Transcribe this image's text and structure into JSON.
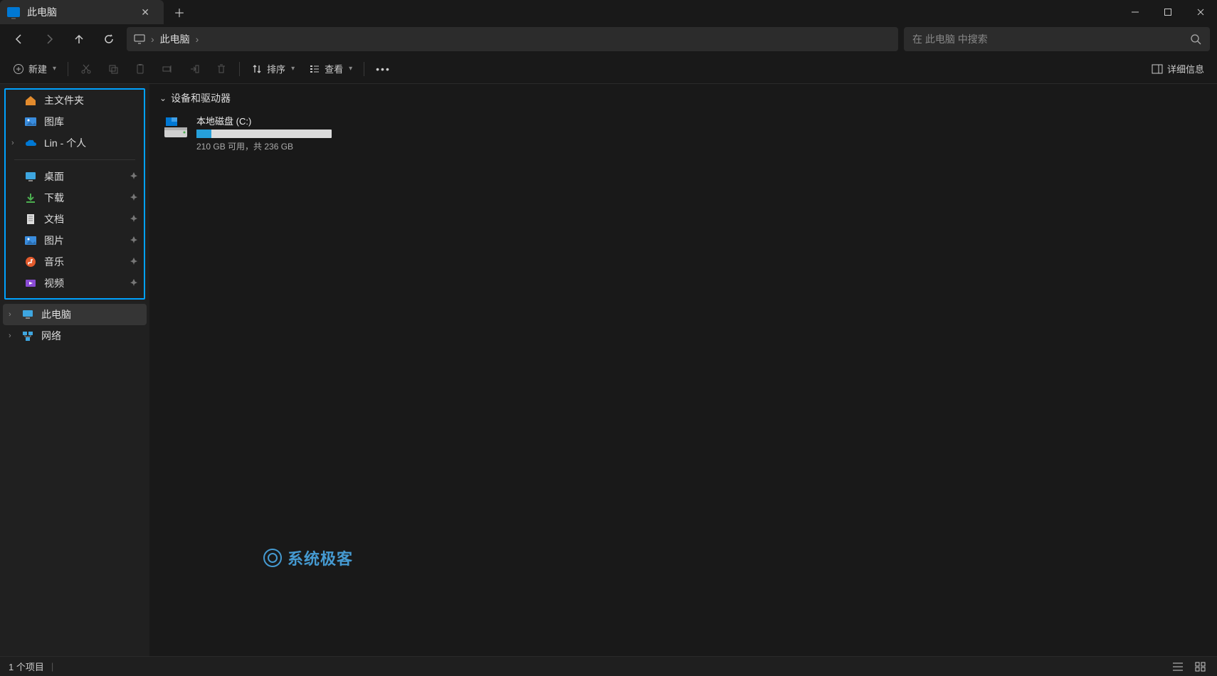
{
  "window": {
    "tab_title": "此电脑"
  },
  "address": {
    "current": "此电脑"
  },
  "search": {
    "placeholder": "在 此电脑 中搜索"
  },
  "toolbar": {
    "new_label": "新建",
    "sort_label": "排序",
    "view_label": "查看",
    "details_label": "详细信息"
  },
  "sidebar": {
    "top": [
      {
        "label": "主文件夹",
        "icon": "home"
      },
      {
        "label": "图库",
        "icon": "gallery"
      },
      {
        "label": "Lin - 个人",
        "icon": "onedrive",
        "expandable": true
      }
    ],
    "quick": [
      {
        "label": "桌面",
        "icon": "desktop"
      },
      {
        "label": "下载",
        "icon": "downloads"
      },
      {
        "label": "文档",
        "icon": "documents"
      },
      {
        "label": "图片",
        "icon": "pictures"
      },
      {
        "label": "音乐",
        "icon": "music"
      },
      {
        "label": "视频",
        "icon": "videos"
      }
    ],
    "bottom": [
      {
        "label": "此电脑",
        "icon": "thispc",
        "selected": true,
        "expandable": true
      },
      {
        "label": "网络",
        "icon": "network",
        "expandable": true
      }
    ]
  },
  "content": {
    "section_title": "设备和驱动器",
    "drive": {
      "label": "本地磁盘 (C:)",
      "subtitle": "210 GB 可用，共 236 GB",
      "fill_percent": 11
    }
  },
  "statusbar": {
    "item_count": "1 个项目"
  },
  "watermark": {
    "text": "系统极客"
  }
}
